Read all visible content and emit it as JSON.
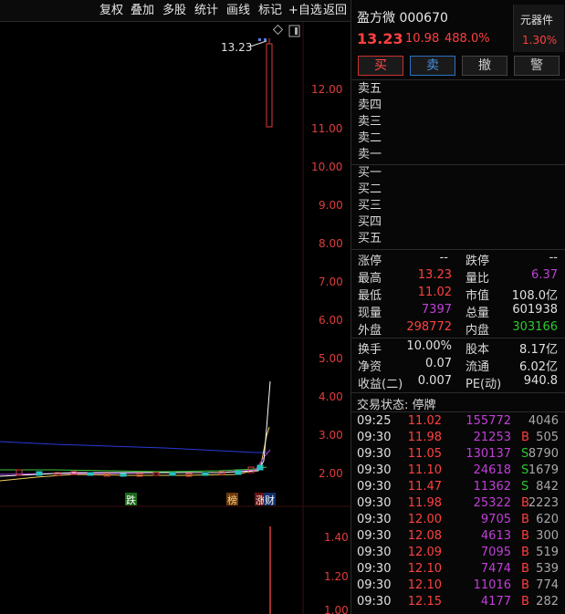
{
  "toolbar": {
    "items": [
      "复权",
      "叠加",
      "多股",
      "统计",
      "画线",
      "标记",
      "+自选",
      "返回"
    ]
  },
  "chart": {
    "y_axis_main": [
      "12.00",
      "11.00",
      "10.00",
      "9.00",
      "8.00",
      "7.00",
      "6.00",
      "5.00",
      "4.00",
      "3.00",
      "2.00"
    ],
    "y_axis_volume": [
      "1.40",
      "1.20",
      "1.00"
    ],
    "high_label": "13.23",
    "event_markers": [
      "跌",
      "榜",
      "涨",
      "财"
    ],
    "colors": {
      "up": "#e03c3c",
      "down": "#29c0c0",
      "ma_yellow": "#f2d05a",
      "ma_white": "#ffffff",
      "ma_purple": "#b040e0",
      "ma_blue": "#2a3ad6",
      "ma_green": "#3cc63c"
    }
  },
  "stock": {
    "name_code": "盈方微 000670",
    "price": "13.23",
    "change": "10.98",
    "change_pct": "488.0%",
    "sector": {
      "name": "元器件",
      "pct": "1.30%"
    }
  },
  "actions": {
    "buy": "买",
    "sell": "卖",
    "cancel": "撤",
    "alert": "警"
  },
  "order_book": {
    "asks": [
      "卖五",
      "卖四",
      "卖三",
      "卖二",
      "卖一"
    ],
    "bids": [
      "买一",
      "买二",
      "买三",
      "买四",
      "买五"
    ]
  },
  "quote": {
    "limit_up_label": "涨停",
    "limit_up_val": "--",
    "limit_down_label": "跌停",
    "limit_down_val": "--",
    "high_label": "最高",
    "high_val": "13.23",
    "ratio_label": "量比",
    "ratio_val": "6.37",
    "low_label": "最低",
    "low_val": "11.02",
    "mcap_label": "市值",
    "mcap_val": "108.0亿",
    "cur_vol_label": "现量",
    "cur_vol_val": "7397",
    "total_vol_label": "总量",
    "total_vol_val": "601938",
    "outer_label": "外盘",
    "outer_val": "298772",
    "inner_label": "内盘",
    "inner_val": "303166",
    "turnover_label": "换手",
    "turnover_val": "10.00%",
    "equity_label": "股本",
    "equity_val": "8.17亿",
    "nav_label": "净资",
    "nav_val": "0.07",
    "float_label": "流通",
    "float_val": "6.02亿",
    "eps_label": "收益(二)",
    "eps_val": "0.007",
    "pe_label": "PE(动)",
    "pe_val": "940.8"
  },
  "status": "交易状态: 停牌",
  "ticks": [
    {
      "time": "09:25",
      "price": "11.02",
      "vol": "155772",
      "side": "",
      "num": "4046"
    },
    {
      "time": "09:30",
      "price": "11.98",
      "vol": "21253",
      "side": "B",
      "num": "505"
    },
    {
      "time": "09:30",
      "price": "11.05",
      "vol": "130137",
      "side": "S",
      "num": "8790"
    },
    {
      "time": "09:30",
      "price": "11.10",
      "vol": "24618",
      "side": "S",
      "num": "1679"
    },
    {
      "time": "09:30",
      "price": "11.47",
      "vol": "11362",
      "side": "S",
      "num": "842"
    },
    {
      "time": "09:30",
      "price": "11.98",
      "vol": "25322",
      "side": "B",
      "num": "2223"
    },
    {
      "time": "09:30",
      "price": "12.00",
      "vol": "9705",
      "side": "B",
      "num": "620"
    },
    {
      "time": "09:30",
      "price": "12.08",
      "vol": "4613",
      "side": "B",
      "num": "300"
    },
    {
      "time": "09:30",
      "price": "12.09",
      "vol": "7095",
      "side": "B",
      "num": "519"
    },
    {
      "time": "09:30",
      "price": "12.10",
      "vol": "7474",
      "side": "B",
      "num": "539"
    },
    {
      "time": "09:30",
      "price": "12.10",
      "vol": "11016",
      "side": "B",
      "num": "774"
    },
    {
      "time": "09:30",
      "price": "12.15",
      "vol": "4177",
      "side": "B",
      "num": "282"
    }
  ]
}
